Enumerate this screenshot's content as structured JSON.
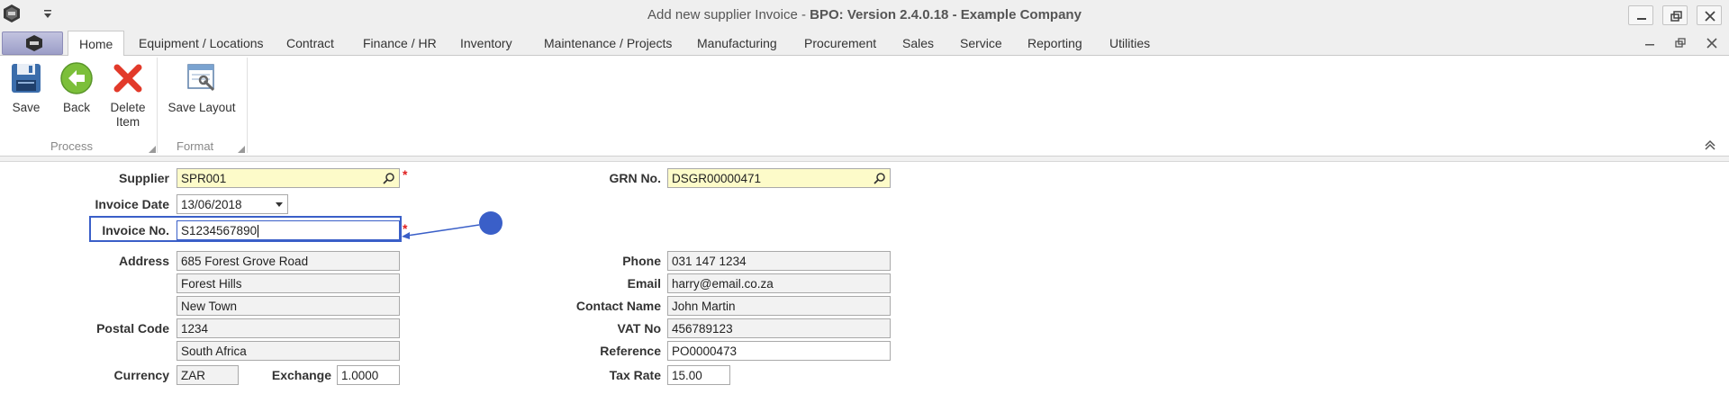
{
  "window": {
    "title_bold_1": "Add new supplier Invoice",
    "title_sep": " - ",
    "title_bold_2": "BPO: Version 2.4.0.18 - Example Company"
  },
  "tabs": [
    {
      "label": "Home",
      "active": true
    },
    {
      "label": "Equipment / Locations"
    },
    {
      "label": "Contract"
    },
    {
      "label": "Finance / HR"
    },
    {
      "label": "Inventory"
    },
    {
      "label": "Maintenance / Projects"
    },
    {
      "label": "Manufacturing"
    },
    {
      "label": "Procurement"
    },
    {
      "label": "Sales"
    },
    {
      "label": "Service"
    },
    {
      "label": "Reporting"
    },
    {
      "label": "Utilities"
    }
  ],
  "ribbon": {
    "process": {
      "label": "Process",
      "save": "Save",
      "back": "Back",
      "delete_line1": "Delete",
      "delete_line2": "Item"
    },
    "format": {
      "label": "Format",
      "save_layout": "Save Layout"
    }
  },
  "form": {
    "supplier": {
      "label": "Supplier",
      "value": "SPR001"
    },
    "invoice_date": {
      "label": "Invoice Date",
      "value": "13/06/2018"
    },
    "invoice_no": {
      "label": "Invoice No.",
      "value": "S1234567890"
    },
    "address": {
      "label": "Address",
      "line1": "685 Forest Grove Road",
      "line2": "Forest Hills",
      "line3": "New Town"
    },
    "postal_code": {
      "label": "Postal Code",
      "value": "1234"
    },
    "country": {
      "value": "South Africa"
    },
    "currency": {
      "label": "Currency",
      "value": "ZAR"
    },
    "exchange": {
      "label": "Exchange",
      "value": "1.0000"
    },
    "grn_no": {
      "label": "GRN No.",
      "value": "DSGR00000471"
    },
    "phone": {
      "label": "Phone",
      "value": "031 147 1234"
    },
    "email": {
      "label": "Email",
      "value": "harry@email.co.za"
    },
    "contact_name": {
      "label": "Contact Name",
      "value": "John Martin"
    },
    "vat_no": {
      "label": "VAT No",
      "value": "456789123"
    },
    "reference": {
      "label": "Reference",
      "value": "PO0000473"
    },
    "tax_rate": {
      "label": "Tax Rate",
      "value": "15.00"
    },
    "required_marker": "*"
  },
  "colors": {
    "required_bg": "#fdfbc9",
    "readonly_bg": "#f2f2f2",
    "focus_border": "#3a5fc8",
    "annotation": "#3a5fc8",
    "required_star": "#e02020"
  }
}
